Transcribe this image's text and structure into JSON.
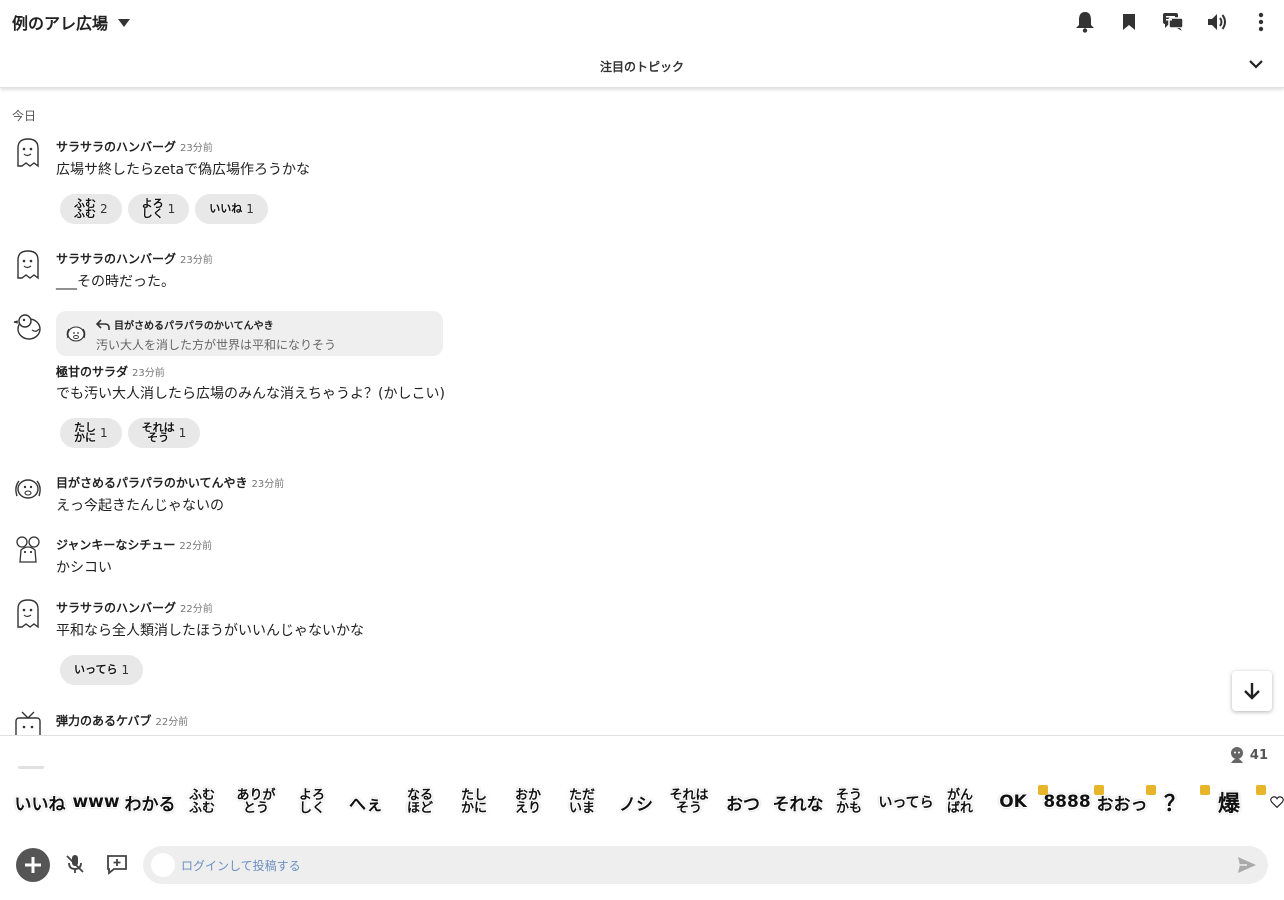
{
  "header": {
    "room_title": "例のアレ広場",
    "icons": [
      "bell-icon",
      "bookmark-icon",
      "chat-bubbles-icon",
      "speaker-icon",
      "more-vertical-icon"
    ]
  },
  "topic_bar": {
    "label": "注目のトピック"
  },
  "chat": {
    "day_label": "今日",
    "messages": [
      {
        "user": "サラサラのハンバーグ",
        "time": "23分前",
        "text": "広場サ終したらzetaで偽広場作ろうかな",
        "reactions": [
          {
            "stamp": "ふむ\nふむ",
            "count": "2"
          },
          {
            "stamp": "よろ\nしく",
            "count": "1"
          },
          {
            "stamp": "いいね",
            "count": "1"
          }
        ]
      },
      {
        "user": "サラサラのハンバーグ",
        "time": "23分前",
        "text": "___その時だった。"
      },
      {
        "user": "極甘のサラダ",
        "time": "23分前",
        "reply_to": {
          "user": "目がさめるパラパラのかいてんやき",
          "text": "汚い大人を消した方が世界は平和になりそう"
        },
        "text": "でも汚い大人消したら広場のみんな消えちゃうよ？(かしこい)",
        "reactions": [
          {
            "stamp": "たし\nかに",
            "count": "1"
          },
          {
            "stamp": "それは\nそう",
            "count": "1"
          }
        ]
      },
      {
        "user": "目がさめるパラパラのかいてんやき",
        "time": "23分前",
        "text": "えっ今起きたんじゃないの"
      },
      {
        "user": "ジャンキーなシチュー",
        "time": "22分前",
        "text": "かシコい"
      },
      {
        "user": "サラサラのハンバーグ",
        "time": "22分前",
        "text": "平和なら全人類消したほうがいいんじゃないかな",
        "reactions": [
          {
            "stamp": "いってら",
            "count": "1"
          }
        ]
      },
      {
        "user": "弾力のあるケバブ",
        "time": "22分前",
        "text": ""
      }
    ]
  },
  "viewer_count": "41",
  "stamps": [
    "いいね",
    "www",
    "わかる",
    "ふむ\nふむ",
    "ありが\nとう",
    "よろ\nしく",
    "へぇ",
    "なる\nほど",
    "たし\nかに",
    "おか\nえり",
    "ただ\nいま",
    "ノシ",
    "それは\nそう",
    "おつ",
    "それな",
    "そう\nかも",
    "いってら",
    "がん\nばれ",
    "OK",
    "8888",
    "おおっ",
    "？",
    "爆"
  ],
  "composer": {
    "placeholder": "ログインして投稿する"
  }
}
